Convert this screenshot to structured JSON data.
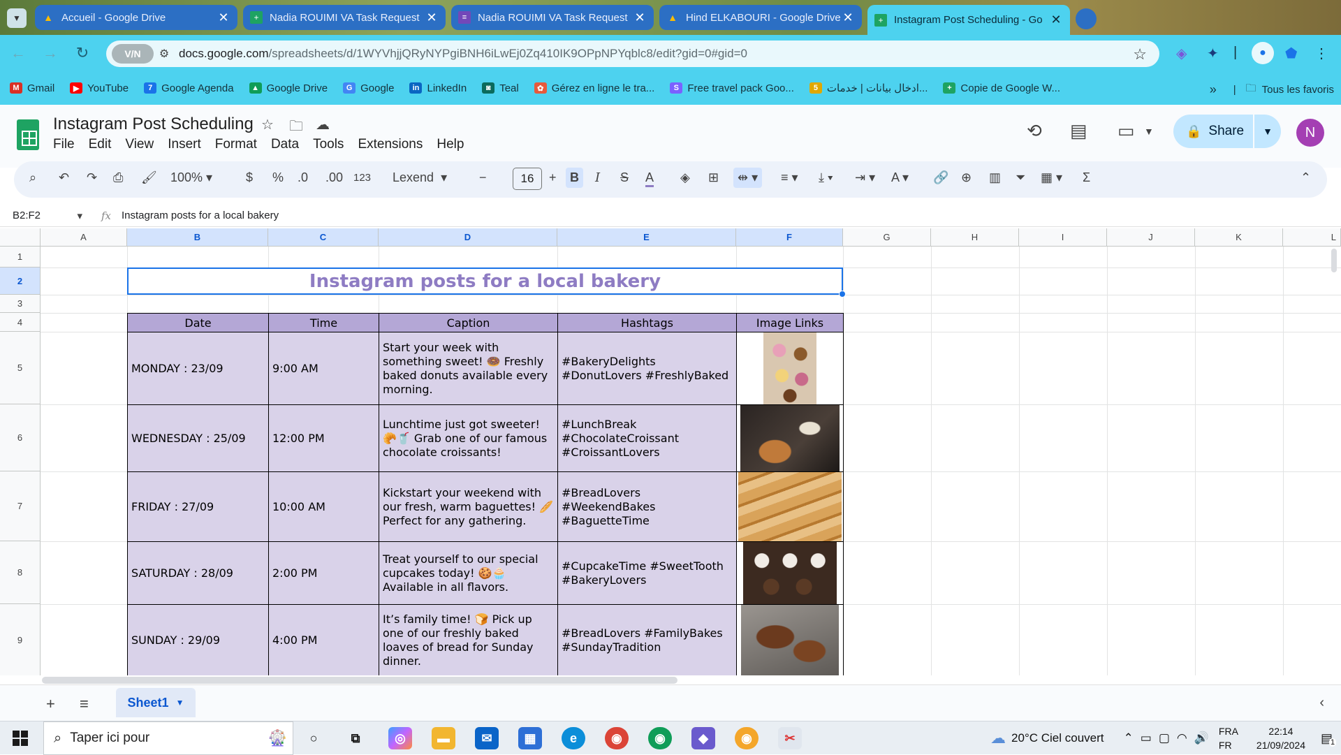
{
  "browser": {
    "tabs": [
      {
        "title": "Accueil - Google Drive",
        "icon": "google-drive-icon"
      },
      {
        "title": "Nadia ROUIMI VA Task Request",
        "icon": "sheets-icon"
      },
      {
        "title": "Nadia ROUIMI VA Task Request",
        "icon": "forms-icon"
      },
      {
        "title": "Hind ELKABOURI - Google Drive",
        "icon": "google-drive-icon"
      },
      {
        "title": "Instagram Post Scheduling - Go",
        "icon": "sheets-icon"
      }
    ],
    "vpn_label": "V/N",
    "url_host": "docs.google.com",
    "url_path": "/spreadsheets/d/1WYVhjjQRyNYPgiBNH6iLwEj0Zq410IK9OPpNPYqblc8/edit?gid=0#gid=0",
    "bookmarks": [
      {
        "label": "Gmail",
        "color": "#d93025",
        "glyph": "M"
      },
      {
        "label": "YouTube",
        "color": "#ff0000",
        "glyph": "▶"
      },
      {
        "label": "Google Agenda",
        "color": "#1a73e8",
        "glyph": "7"
      },
      {
        "label": "Google Drive",
        "color": "#0f9d58",
        "glyph": "▲"
      },
      {
        "label": "Google",
        "color": "#4285f4",
        "glyph": "G"
      },
      {
        "label": "LinkedIn",
        "color": "#0a66c2",
        "glyph": "in"
      },
      {
        "label": "Teal",
        "color": "#0b6b5d",
        "glyph": "◙"
      },
      {
        "label": "Gérez en ligne le tra...",
        "color": "#e65a3c",
        "glyph": "✿"
      },
      {
        "label": "Free travel pack Goo...",
        "color": "#7b61ff",
        "glyph": "S"
      },
      {
        "label": "ادخال بيانات | خدمات...",
        "color": "#e0a800",
        "glyph": "5"
      },
      {
        "label": "Copie de Google W...",
        "color": "#1ea362",
        "glyph": "+"
      }
    ],
    "bookmarks_overflow": "»",
    "all_bookmarks": "Tous les favoris"
  },
  "doc": {
    "title": "Instagram Post Scheduling",
    "menus": [
      "File",
      "Edit",
      "View",
      "Insert",
      "Format",
      "Data",
      "Tools",
      "Extensions",
      "Help"
    ],
    "share_label": "Share",
    "avatar_letter": "N"
  },
  "toolbar": {
    "zoom": "100%",
    "currency": "$",
    "percent": "%",
    "dec_decrease": ".0",
    "dec_increase": ".00",
    "number_format": "123",
    "font": "Lexend",
    "font_size": "16",
    "bold": "B",
    "italic": "I"
  },
  "formula_bar": {
    "name_box": "B2:F2",
    "fx": "fx",
    "content": "Instagram posts for a local bakery"
  },
  "grid": {
    "columns": [
      "A",
      "B",
      "C",
      "D",
      "E",
      "F",
      "G",
      "H",
      "I",
      "J",
      "K",
      "L"
    ],
    "rows": [
      "1",
      "2",
      "3",
      "4",
      "5",
      "6",
      "7",
      "8",
      "9"
    ],
    "title": "Instagram posts for a local bakery",
    "headers": {
      "date": "Date",
      "time": "Time",
      "caption": "Caption",
      "hashtags": "Hashtags",
      "images": "Image Links"
    },
    "posts": [
      {
        "date": "MONDAY : 23/09",
        "time": "9:00 AM",
        "caption": "Start your week with something sweet! 🍩 Freshly baked donuts available every morning.",
        "hashtags": "#BakeryDelights #DonutLovers #FreshlyBaked",
        "image": "donuts-photo"
      },
      {
        "date": "WEDNESDAY : 25/09",
        "time": "12:00 PM",
        "caption": "Lunchtime just got sweeter! 🥐🥤 Grab one of our famous chocolate croissants!",
        "hashtags": "#LunchBreak #ChocolateCroissant #CroissantLovers",
        "image": "croissant-photo"
      },
      {
        "date": "FRIDAY : 27/09",
        "time": "10:00 AM",
        "caption": "Kickstart your weekend with our fresh, warm baguettes! 🥖 Perfect for any gathering.",
        "hashtags": "#BreadLovers #WeekendBakes #BaguetteTime",
        "image": "baguette-photo"
      },
      {
        "date": "SATURDAY : 28/09",
        "time": "2:00 PM",
        "caption": "Treat yourself to our special cupcakes today! 🍪🧁 Available in all flavors.",
        "hashtags": "#CupcakeTime #SweetTooth #BakeryLovers",
        "image": "cupcakes-photo"
      },
      {
        "date": "SUNDAY : 29/09",
        "time": "4:00 PM",
        "caption": "It’s family time! 🍞 Pick up one of our freshly baked loaves of bread for Sunday dinner.",
        "hashtags": "#BreadLovers #FamilyBakes #SundayTradition",
        "image": "bread-photo"
      }
    ]
  },
  "sheets": {
    "active": "Sheet1"
  },
  "taskbar": {
    "search_placeholder": "Taper ici pour",
    "weather": "20°C  Ciel couvert",
    "lang_top": "FRA",
    "lang_bottom": "FR",
    "time": "22:14",
    "date": "21/09/2024",
    "notifications": "1"
  }
}
